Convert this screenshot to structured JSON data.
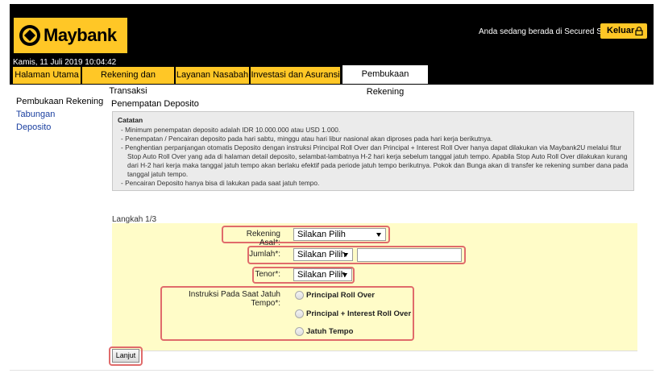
{
  "header": {
    "brand": "Maybank",
    "secured_text": "Anda sedang berada di Secured Site",
    "logout_label": "Keluar",
    "datetime": "Kamis, 11 Juli 2019 10:04:42",
    "brand_color": "#ffc726"
  },
  "tabs": [
    {
      "label": "Halaman Utama",
      "active": false
    },
    {
      "label": "Rekening dan Transaksi",
      "active": false
    },
    {
      "label": "Layanan Nasabah",
      "active": false
    },
    {
      "label": "Investasi dan Asuransi",
      "active": false
    },
    {
      "label": "Pembukaan Rekening",
      "active": true
    }
  ],
  "sidebar": {
    "title": "Pembukaan Rekening",
    "items": [
      {
        "label": "Tabungan"
      },
      {
        "label": "Deposito"
      }
    ]
  },
  "main": {
    "title": "Penempatan Deposito",
    "notes": {
      "title": "Catatan",
      "lines": [
        "- Minimum penempatan deposito adalah IDR 10.000.000 atau USD 1.000.",
        "- Penempatan / Pencairan deposito pada hari sabtu, minggu atau hari libur nasional akan diproses pada hari kerja berikutnya.",
        "- Penghentian perpanjangan otomatis Deposito dengan instruksi Principal Roll Over dan Principal + Interest Roll Over hanya dapat dilakukan via Maybank2U melalui fitur Stop Auto Roll Over yang ada di halaman detail deposito, selambat-lambatnya H-2 hari kerja sebelum tanggal jatuh tempo. Apabila Stop Auto Roll Over dilakukan kurang dari H-2 hari kerja maka tanggal jatuh tempo akan berlaku efektif pada periode jatuh tempo berikutnya. Pokok dan Bunga akan di transfer ke rekening sumber dana pada tanggal jatuh tempo.",
        "- Pencairan Deposito hanya bisa di lakukan pada saat jatuh tempo."
      ]
    },
    "step": "Langkah 1/3",
    "form": {
      "source_account": {
        "label": "Rekening Asal*:",
        "value": "Silakan Pilih"
      },
      "amount": {
        "label": "Jumlah*:",
        "currency": "Silakan Pilih",
        "value": ""
      },
      "tenor": {
        "label": "Tenor*:",
        "value": "Silakan Pilih"
      },
      "maturity": {
        "label": "Instruksi Pada Saat Jatuh Tempo*:",
        "options": [
          {
            "label": "Principal Roll Over"
          },
          {
            "label": "Principal + Interest Roll Over"
          },
          {
            "label": "Jatuh Tempo"
          }
        ]
      }
    },
    "next_label": "Lanjut"
  }
}
